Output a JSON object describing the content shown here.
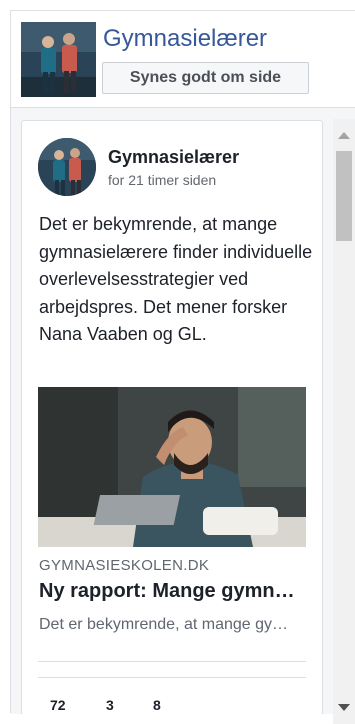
{
  "page": {
    "name": "Gymnasielærer",
    "like_label": "Synes godt om side"
  },
  "post": {
    "author": "Gymnasielærer",
    "time": "for 21 timer siden",
    "text": "Det er bekymrende, at mange gymnasielærere finder individuelle overlevelsesstrategier ved arbejdspres. Det mener forsker Nana Vaaben og GL.",
    "link": {
      "domain": "GYMNASIESKOLEN.DK",
      "title": "Ny rapport: Mange gymnasielærere har individuelle overlevelsesstrategier",
      "description": "Det er bekymrende, at mange gymnasielærere finder individuelle overlevelsesstrategier"
    },
    "stats": {
      "reactions": "72",
      "comments": "3",
      "shares": "8"
    }
  },
  "colors": {
    "brand_link": "#365899",
    "border": "#dddfe2"
  },
  "icons": {
    "scroll_up": "scroll-up-arrow-icon",
    "scroll_down": "scroll-down-arrow-icon"
  }
}
